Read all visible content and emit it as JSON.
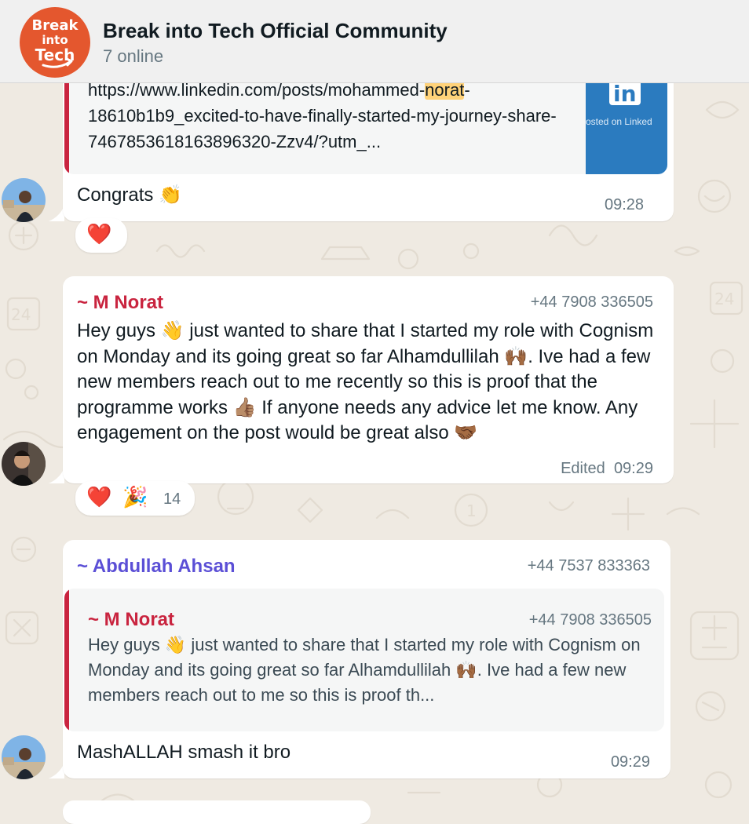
{
  "header": {
    "title": "Break into Tech Official Community",
    "status": "7 online",
    "logo_lines": [
      "Break",
      "into",
      "Tech"
    ]
  },
  "messages": [
    {
      "link_preview": {
        "url_before": "https://www.linkedin.com/posts/mohammed-",
        "url_highlight": "norat",
        "url_after": "-18610b1b9_excited-to-have-finally-started-my-journey-share-7467853618163896320-Zzv4/?utm_...",
        "thumb_label": "osted on Linked"
      },
      "text": "Congrats 👏",
      "time": "09:28",
      "reactions": [
        "❤️"
      ]
    },
    {
      "sender": "~ M Norat",
      "phone": "+44 7908 336505",
      "text": "Hey guys 👋 just wanted to share that I started my role with Cognism on Monday and its going great so far Alhamdullilah 🙌🏾. Ive had a few new members reach out to me recently so this is proof that the programme works 👍🏽 If anyone needs any advice let me know. Any engagement on the post would be great also 🤝🏾",
      "edited": "Edited",
      "time": "09:29",
      "reactions": [
        "❤️",
        "🎉"
      ],
      "reaction_count": "14"
    },
    {
      "sender": "~ Abdullah Ahsan",
      "phone": "+44 7537 833363",
      "quoted": {
        "sender": "~ M Norat",
        "phone": "+44 7908 336505",
        "text": "Hey guys 👋 just wanted to share that I started my role with Cognism on Monday and its going great so far Alhamdullilah 🙌🏾. Ive had a few new members reach out to me so this is proof th..."
      },
      "text": "MashALLAH smash it bro",
      "time": "09:29"
    }
  ],
  "colors": {
    "background": "#efeae2",
    "header_bg": "#f0f0f0",
    "bubble": "#ffffff",
    "norat": "#c9243f",
    "abdullah": "#5b4fd6",
    "meta": "#667781",
    "logo": "#e4572e",
    "highlight": "#ffd279"
  },
  "icons": [
    "doodle-pattern",
    "group-logo",
    "linkedin-logo",
    "user-avatar",
    "heart",
    "party-popper",
    "wave",
    "clap",
    "raised-hands",
    "thumbs-up",
    "handshake"
  ]
}
